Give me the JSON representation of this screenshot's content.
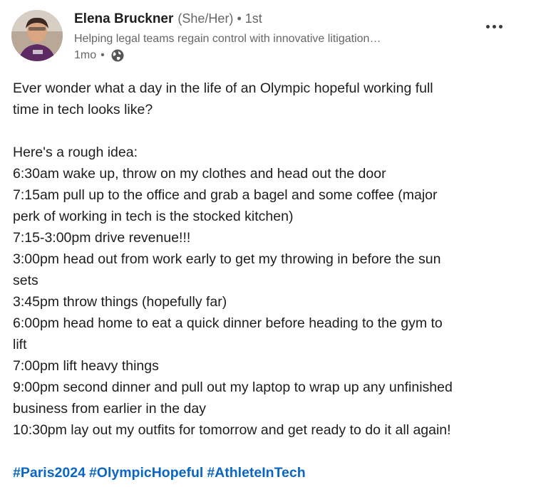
{
  "author": {
    "name": "Elena Bruckner",
    "pronouns": "(She/Her)",
    "separator": "•",
    "degree": "1st",
    "headline": "Helping legal teams regain control with innovative litigation…",
    "time": "1mo",
    "time_separator": "•",
    "visibility_icon": "globe-icon"
  },
  "actions": {
    "more_icon": "more-horizontal-icon"
  },
  "post": {
    "intro_lines": [
      "Ever wonder what a day in the life of an Olympic hopeful working full",
      "time in tech looks like?"
    ],
    "schedule_lines": [
      "Here's a rough idea:",
      "6:30am wake up, throw on my clothes and head out the door",
      "7:15am pull up to the office and grab a bagel and some coffee (major",
      "perk of working in tech is the stocked kitchen)",
      "7:15-3:00pm drive revenue!!!",
      "3:00pm head out from work early to get my throwing in before the sun",
      "sets",
      "3:45pm throw things (hopefully far)",
      "6:00pm head home to eat a quick dinner before heading to the gym to",
      "lift",
      "7:00pm lift heavy things",
      "9:00pm second dinner and pull out my laptop to wrap up any unfinished",
      "business from earlier in the day",
      "10:30pm lay out my outfits for tomorrow and get ready to do it all again!"
    ],
    "hashtags": [
      "#Paris2024",
      "#OlympicHopeful",
      "#AthleteInTech"
    ]
  },
  "colors": {
    "hashtag": "#0a66c2",
    "text": "#1d1d1d",
    "secondary_text": "#666666"
  }
}
